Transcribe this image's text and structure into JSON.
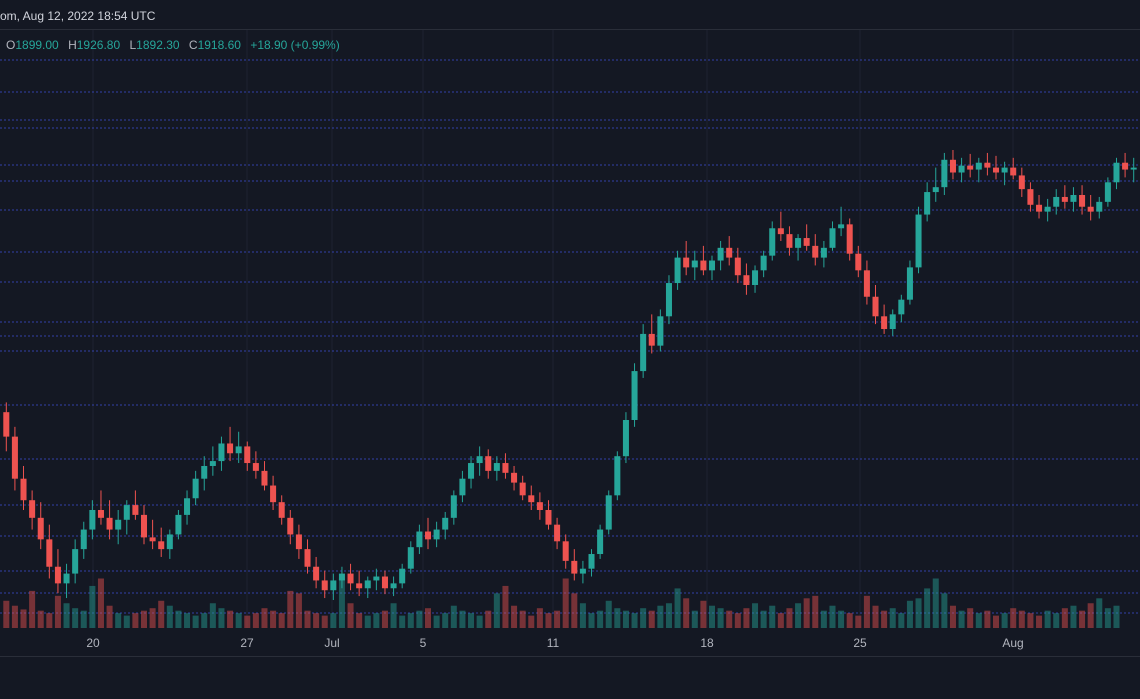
{
  "header": {
    "source_time": "om, Aug 12, 2022 18:54 UTC"
  },
  "ohlc": {
    "o_label": "O",
    "o_value": "1899.00",
    "h_label": "H",
    "h_value": "1926.80",
    "l_label": "L",
    "l_value": "1892.30",
    "c_label": "C",
    "c_value": "1918.60",
    "change": "+18.90 (+0.99%)"
  },
  "colors": {
    "background": "#141823",
    "up": "#26a69a",
    "down": "#ef5350",
    "grid_horizontal": "#3a4bc8",
    "grid_vertical": "#1e2230"
  },
  "chart_data": {
    "type": "candlestick",
    "x_tick_labels": [
      "20",
      "27",
      "Jul",
      "5",
      "11",
      "18",
      "25",
      "Aug"
    ],
    "grid": true,
    "series": [
      {
        "kind": "ohlc",
        "values": [
          [
            1780,
            1790,
            1740,
            1755
          ],
          [
            1755,
            1765,
            1700,
            1712
          ],
          [
            1712,
            1725,
            1680,
            1690
          ],
          [
            1690,
            1700,
            1660,
            1672
          ],
          [
            1672,
            1688,
            1640,
            1650
          ],
          [
            1650,
            1665,
            1610,
            1622
          ],
          [
            1622,
            1640,
            1595,
            1605
          ],
          [
            1605,
            1625,
            1590,
            1615
          ],
          [
            1615,
            1650,
            1605,
            1640
          ],
          [
            1640,
            1668,
            1630,
            1660
          ],
          [
            1660,
            1690,
            1650,
            1680
          ],
          [
            1680,
            1700,
            1665,
            1672
          ],
          [
            1672,
            1690,
            1650,
            1660
          ],
          [
            1660,
            1680,
            1645,
            1670
          ],
          [
            1670,
            1690,
            1655,
            1685
          ],
          [
            1685,
            1700,
            1670,
            1675
          ],
          [
            1675,
            1685,
            1645,
            1652
          ],
          [
            1652,
            1670,
            1640,
            1648
          ],
          [
            1648,
            1662,
            1632,
            1640
          ],
          [
            1640,
            1660,
            1630,
            1655
          ],
          [
            1655,
            1680,
            1650,
            1675
          ],
          [
            1675,
            1700,
            1665,
            1692
          ],
          [
            1692,
            1720,
            1685,
            1712
          ],
          [
            1712,
            1735,
            1700,
            1725
          ],
          [
            1725,
            1745,
            1715,
            1730
          ],
          [
            1730,
            1755,
            1720,
            1748
          ],
          [
            1748,
            1765,
            1730,
            1738
          ],
          [
            1738,
            1760,
            1728,
            1745
          ],
          [
            1745,
            1750,
            1720,
            1728
          ],
          [
            1728,
            1740,
            1712,
            1720
          ],
          [
            1720,
            1730,
            1700,
            1705
          ],
          [
            1705,
            1715,
            1680,
            1688
          ],
          [
            1688,
            1695,
            1665,
            1672
          ],
          [
            1672,
            1680,
            1645,
            1655
          ],
          [
            1655,
            1665,
            1630,
            1640
          ],
          [
            1640,
            1650,
            1615,
            1622
          ],
          [
            1622,
            1632,
            1600,
            1608
          ],
          [
            1608,
            1618,
            1590,
            1598
          ],
          [
            1598,
            1615,
            1588,
            1608
          ],
          [
            1608,
            1622,
            1600,
            1615
          ],
          [
            1615,
            1625,
            1598,
            1605
          ],
          [
            1605,
            1618,
            1592,
            1600
          ],
          [
            1600,
            1612,
            1590,
            1608
          ],
          [
            1608,
            1620,
            1598,
            1612
          ],
          [
            1612,
            1618,
            1594,
            1600
          ],
          [
            1600,
            1612,
            1592,
            1605
          ],
          [
            1605,
            1625,
            1600,
            1620
          ],
          [
            1620,
            1648,
            1615,
            1642
          ],
          [
            1642,
            1665,
            1635,
            1658
          ],
          [
            1658,
            1672,
            1640,
            1650
          ],
          [
            1650,
            1668,
            1642,
            1660
          ],
          [
            1660,
            1678,
            1650,
            1672
          ],
          [
            1672,
            1700,
            1665,
            1695
          ],
          [
            1695,
            1720,
            1688,
            1712
          ],
          [
            1712,
            1735,
            1702,
            1728
          ],
          [
            1728,
            1745,
            1715,
            1735
          ],
          [
            1735,
            1742,
            1712,
            1720
          ],
          [
            1720,
            1735,
            1710,
            1728
          ],
          [
            1728,
            1738,
            1712,
            1718
          ],
          [
            1718,
            1725,
            1700,
            1708
          ],
          [
            1708,
            1715,
            1690,
            1695
          ],
          [
            1695,
            1705,
            1680,
            1688
          ],
          [
            1688,
            1698,
            1670,
            1680
          ],
          [
            1680,
            1690,
            1660,
            1665
          ],
          [
            1665,
            1672,
            1640,
            1648
          ],
          [
            1648,
            1655,
            1620,
            1628
          ],
          [
            1628,
            1640,
            1608,
            1615
          ],
          [
            1615,
            1628,
            1605,
            1620
          ],
          [
            1620,
            1640,
            1612,
            1635
          ],
          [
            1635,
            1665,
            1630,
            1660
          ],
          [
            1660,
            1700,
            1655,
            1695
          ],
          [
            1695,
            1740,
            1690,
            1735
          ],
          [
            1735,
            1780,
            1728,
            1772
          ],
          [
            1772,
            1830,
            1765,
            1822
          ],
          [
            1822,
            1870,
            1815,
            1860
          ],
          [
            1860,
            1880,
            1840,
            1848
          ],
          [
            1848,
            1885,
            1842,
            1878
          ],
          [
            1878,
            1920,
            1870,
            1912
          ],
          [
            1912,
            1945,
            1905,
            1938
          ],
          [
            1938,
            1955,
            1920,
            1928
          ],
          [
            1928,
            1945,
            1915,
            1935
          ],
          [
            1935,
            1950,
            1920,
            1925
          ],
          [
            1925,
            1940,
            1915,
            1935
          ],
          [
            1935,
            1955,
            1925,
            1948
          ],
          [
            1948,
            1960,
            1930,
            1938
          ],
          [
            1938,
            1948,
            1912,
            1920
          ],
          [
            1920,
            1932,
            1900,
            1910
          ],
          [
            1910,
            1930,
            1902,
            1925
          ],
          [
            1925,
            1945,
            1918,
            1940
          ],
          [
            1940,
            1975,
            1935,
            1968
          ],
          [
            1968,
            1985,
            1955,
            1962
          ],
          [
            1962,
            1970,
            1940,
            1948
          ],
          [
            1948,
            1962,
            1935,
            1958
          ],
          [
            1958,
            1972,
            1945,
            1950
          ],
          [
            1950,
            1962,
            1930,
            1938
          ],
          [
            1938,
            1955,
            1928,
            1948
          ],
          [
            1948,
            1975,
            1945,
            1968
          ],
          [
            1968,
            1990,
            1960,
            1972
          ],
          [
            1972,
            1978,
            1935,
            1942
          ],
          [
            1942,
            1950,
            1918,
            1925
          ],
          [
            1925,
            1935,
            1890,
            1898
          ],
          [
            1898,
            1910,
            1870,
            1878
          ],
          [
            1878,
            1890,
            1860,
            1865
          ],
          [
            1865,
            1885,
            1858,
            1880
          ],
          [
            1880,
            1900,
            1872,
            1895
          ],
          [
            1895,
            1935,
            1890,
            1928
          ],
          [
            1928,
            1990,
            1922,
            1982
          ],
          [
            1982,
            2015,
            1975,
            2005
          ],
          [
            2005,
            2030,
            1995,
            2010
          ],
          [
            2010,
            2045,
            2002,
            2038
          ],
          [
            2038,
            2048,
            2018,
            2025
          ],
          [
            2025,
            2040,
            2015,
            2032
          ],
          [
            2032,
            2044,
            2020,
            2028
          ],
          [
            2028,
            2040,
            2015,
            2035
          ],
          [
            2035,
            2045,
            2022,
            2030
          ],
          [
            2030,
            2042,
            2018,
            2025
          ],
          [
            2025,
            2036,
            2012,
            2030
          ],
          [
            2030,
            2040,
            2018,
            2022
          ],
          [
            2022,
            2030,
            2000,
            2008
          ],
          [
            2008,
            2015,
            1985,
            1992
          ],
          [
            1992,
            2002,
            1978,
            1985
          ],
          [
            1985,
            1998,
            1975,
            1990
          ],
          [
            1990,
            2008,
            1982,
            2000
          ],
          [
            2000,
            2012,
            1988,
            1995
          ],
          [
            1995,
            2010,
            1985,
            2002
          ],
          [
            2002,
            2012,
            1982,
            1990
          ],
          [
            1990,
            2002,
            1976,
            1985
          ],
          [
            1985,
            2000,
            1978,
            1995
          ],
          [
            1995,
            2020,
            1990,
            2015
          ],
          [
            2015,
            2040,
            2008,
            2035
          ],
          [
            2035,
            2045,
            2020,
            2028
          ],
          [
            2028,
            2040,
            2015,
            2030
          ]
        ]
      },
      {
        "kind": "volume",
        "values": [
          22,
          18,
          15,
          30,
          14,
          12,
          26,
          20,
          16,
          14,
          34,
          40,
          18,
          12,
          10,
          12,
          14,
          16,
          22,
          18,
          14,
          12,
          10,
          12,
          20,
          16,
          14,
          12,
          10,
          12,
          16,
          14,
          12,
          30,
          28,
          14,
          12,
          10,
          12,
          40,
          20,
          12,
          10,
          12,
          14,
          20,
          10,
          12,
          14,
          16,
          10,
          12,
          18,
          14,
          12,
          10,
          14,
          28,
          34,
          18,
          14,
          10,
          16,
          12,
          14,
          40,
          28,
          20,
          12,
          14,
          22,
          16,
          14,
          12,
          16,
          14,
          18,
          20,
          32,
          24,
          14,
          22,
          18,
          16,
          14,
          12,
          16,
          20,
          14,
          18,
          12,
          16,
          20,
          24,
          26,
          14,
          18,
          14,
          12,
          10,
          26,
          18,
          14,
          16,
          12,
          22,
          24,
          32,
          40,
          28,
          18,
          14,
          16,
          12,
          14,
          10,
          12,
          16,
          14,
          12,
          10,
          14,
          12,
          16,
          18,
          14,
          20,
          24,
          16,
          18
        ]
      }
    ]
  }
}
